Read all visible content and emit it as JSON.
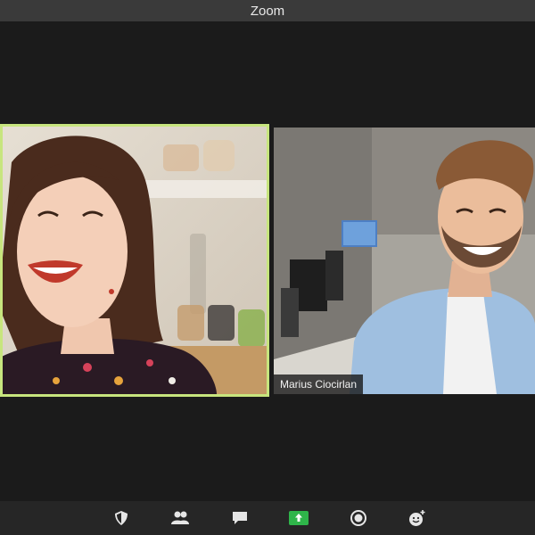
{
  "window": {
    "title": "Zoom"
  },
  "participants": [
    {
      "name": "",
      "active_speaker": true
    },
    {
      "name": "Marius Ciocirlan",
      "active_speaker": false
    }
  ],
  "toolbar": {
    "buttons": [
      {
        "icon": "security-shield-icon"
      },
      {
        "icon": "participants-icon"
      },
      {
        "icon": "chat-icon"
      },
      {
        "icon": "share-screen-icon"
      },
      {
        "icon": "record-icon"
      },
      {
        "icon": "reactions-icon"
      }
    ]
  },
  "colors": {
    "active_speaker_border": "#c7e57e",
    "share_green": "#2fb54a",
    "toolbar_bg": "#262626",
    "titlebar_bg": "#3a3a3a"
  }
}
